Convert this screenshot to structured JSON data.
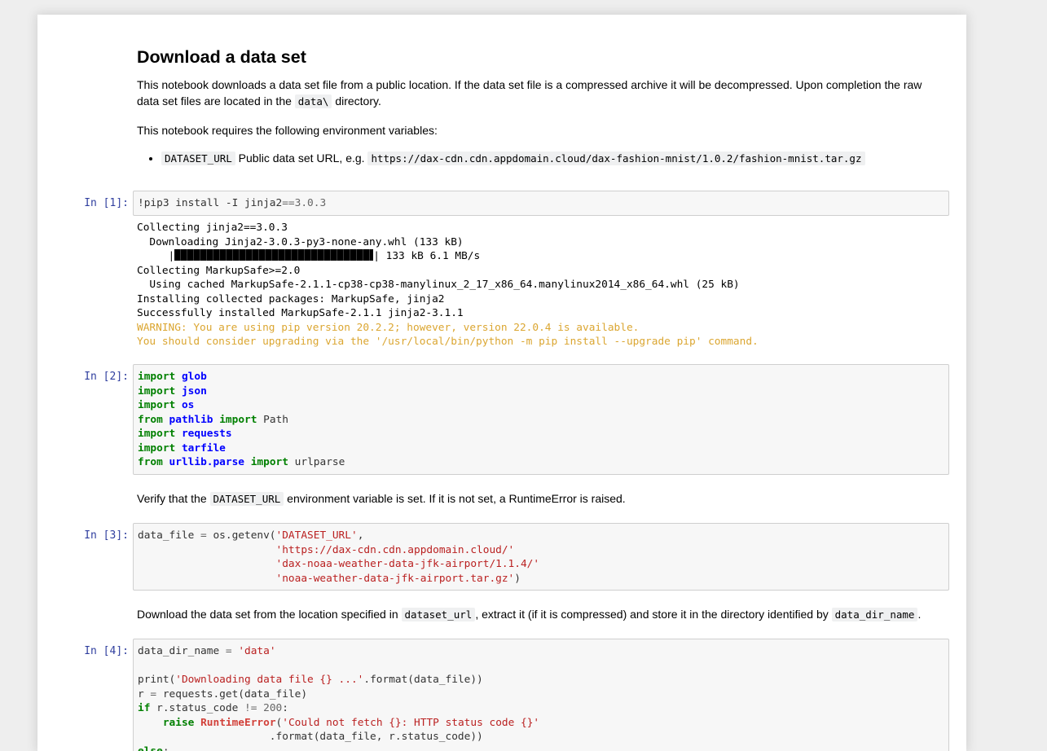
{
  "intro": {
    "heading": "Download a data set",
    "para1_a": "This notebook downloads a data set file from a public location. If the data set file is a compressed archive it will be decompressed. Upon completion the raw data set files are located in the ",
    "para1_code": "data\\",
    "para1_b": " directory.",
    "para2": "This notebook requires the following environment variables:",
    "env_var_name": "DATASET_URL",
    "env_var_desc": " Public data set URL, e.g. ",
    "env_var_example": "https://dax-cdn.cdn.appdomain.cloud/dax-fashion-mnist/1.0.2/fashion-mnist.tar.gz"
  },
  "cell1": {
    "prompt": "In [1]:",
    "code_a": "!pip3 install -I jinja2",
    "code_op": "==",
    "code_b": "3.0.3",
    "output": {
      "l1": "Collecting jinja2==3.0.3",
      "l2": "  Downloading Jinja2-3.0.3-py3-none-any.whl (133 kB)",
      "l3_pre": "     |",
      "l3_post": "| 133 kB 6.1 MB/s",
      "l4": "Collecting MarkupSafe>=2.0",
      "l5": "  Using cached MarkupSafe-2.1.1-cp38-cp38-manylinux_2_17_x86_64.manylinux2014_x86_64.whl (25 kB)",
      "l6": "Installing collected packages: MarkupSafe, jinja2",
      "l7": "Successfully installed MarkupSafe-2.1.1 jinja2-3.1.1",
      "w1": "WARNING: You are using pip version 20.2.2; however, version 22.0.4 is available.",
      "w2": "You should consider upgrading via the '/usr/local/bin/python -m pip install --upgrade pip' command."
    }
  },
  "cell2": {
    "prompt": "In [2]:",
    "kw_import": "import",
    "kw_from": "from",
    "m_glob": "glob",
    "m_json": "json",
    "m_os": "os",
    "m_pathlib": "pathlib",
    "n_path": "Path",
    "m_requests": "requests",
    "m_tarfile": "tarfile",
    "m_urllib": "urllib.parse",
    "n_urlparse": "urlparse"
  },
  "md3": {
    "a": "Verify that the ",
    "code": "DATASET_URL",
    "b": " environment variable is set. If it is not set, a RuntimeError is raised."
  },
  "cell3": {
    "prompt": "In [3]:",
    "l1_a": "data_file ",
    "l1_op": "=",
    "l1_b": " os.getenv(",
    "l1_s": "'DATASET_URL'",
    "l1_c": ",",
    "l2_s": "'https://dax-cdn.cdn.appdomain.cloud/'",
    "l3_s": "'dax-noaa-weather-data-jfk-airport/1.1.4/'",
    "l4_s": "'noaa-weather-data-jfk-airport.tar.gz'",
    "l4_c": ")"
  },
  "md4": {
    "a": "Download the data set from the location specified in ",
    "code1": "dataset_url",
    "b": ", extract it (if it is compressed) and store it in the directory identified by ",
    "code2": "data_dir_name",
    "c": "."
  },
  "cell4": {
    "prompt": "In [4]:",
    "l1_a": "data_dir_name ",
    "l1_op": "=",
    "l1_s": "'data'",
    "l3_a": "print(",
    "l3_s": "'Downloading data file {} ...'",
    "l3_b": ".format(data_file))",
    "l4_a": "r ",
    "l4_op": "=",
    "l4_b": " requests.get(data_file)",
    "l5_kw": "if",
    "l5_a": " r.status_code ",
    "l5_op": "!=",
    "l5_n": "200",
    "l5_b": ":",
    "l6_kw": "raise",
    "l6_exc": "RuntimeError",
    "l6_a": "(",
    "l6_s": "'Could not fetch {}: HTTP status code {}'",
    "l7": "                     .format(data_file, r.status_code))",
    "l8_kw": "else",
    "l8_b": ":"
  }
}
